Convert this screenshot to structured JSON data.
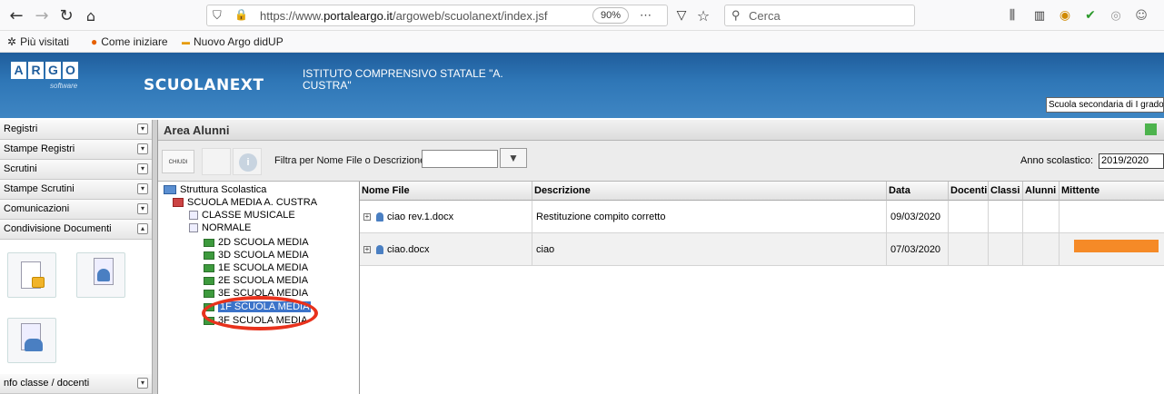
{
  "browser": {
    "url_prefix": "https://www.",
    "url_domain": "portaleargo.it",
    "url_path": "/argoweb/scuolanext/index.jsf",
    "zoom": "90%",
    "search_placeholder": "Cerca",
    "bookmarks": [
      "Più visitati",
      "Come iniziare",
      "Nuovo Argo didUP"
    ]
  },
  "header": {
    "logo_letters": [
      "A",
      "R",
      "G",
      "O"
    ],
    "logo_sub": "software",
    "product": "SCUOLANEXT",
    "istituto": "ISTITUTO COMPRENSIVO STATALE \"A. CUSTRA\"",
    "scuola": "Scuola secondaria di I grado"
  },
  "sidebar": {
    "items": [
      {
        "label": "Registri"
      },
      {
        "label": "Stampe Registri"
      },
      {
        "label": "Scrutini"
      },
      {
        "label": "Stampe Scrutini"
      },
      {
        "label": "Comunicazioni"
      },
      {
        "label": "Condivisione Documenti"
      },
      {
        "label": "nfo classe / docenti"
      }
    ]
  },
  "area": {
    "title": "Area Alunni",
    "chiudi": "CHIUDI",
    "filter_label": "Filtra per Nome File o Descrizione:",
    "filter_value": "",
    "anno_label": "Anno scolastico:",
    "anno_value": "2019/2020"
  },
  "tree": {
    "root": "Struttura Scolastica",
    "school": "SCUOLA MEDIA A. CUSTRA",
    "groups": [
      "CLASSE MUSICALE",
      "NORMALE"
    ],
    "classes": [
      "2D SCUOLA MEDIA",
      "3D SCUOLA MEDIA",
      "1E SCUOLA MEDIA",
      "2E SCUOLA MEDIA",
      "3E SCUOLA MEDIA",
      "1F SCUOLA MEDIA",
      "3F SCUOLA MEDIA"
    ],
    "selected": "1F SCUOLA MEDIA"
  },
  "table": {
    "columns": [
      "Nome File",
      "Descrizione",
      "Data",
      "Docenti",
      "Classi",
      "Alunni",
      "Mittente"
    ],
    "rows": [
      {
        "file": "ciao rev.1.docx",
        "desc": "Restituzione compito corretto",
        "date": "09/03/2020"
      },
      {
        "file": "ciao.docx",
        "desc": "ciao",
        "date": "07/03/2020"
      }
    ]
  },
  "colors": {
    "banner": "#2f77b7",
    "selection": "#3b73c9",
    "highlight": "#e8321d",
    "sender_bar": "#f58a27"
  }
}
